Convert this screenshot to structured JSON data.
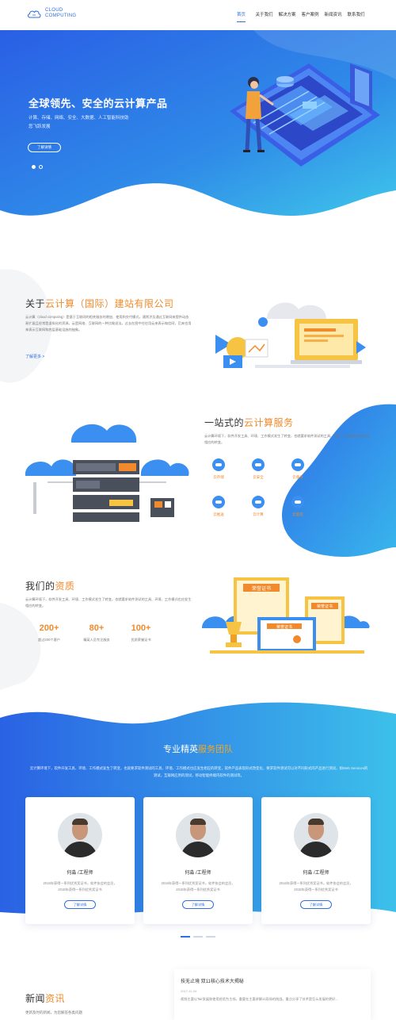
{
  "header": {
    "logo_line1": "CLOUD",
    "logo_line2": "COMPUTING",
    "nav": [
      {
        "label": "首页",
        "active": true
      },
      {
        "label": "关于我们",
        "active": false
      },
      {
        "label": "解决方案",
        "active": false
      },
      {
        "label": "客户案例",
        "active": false
      },
      {
        "label": "新闻资讯",
        "active": false
      },
      {
        "label": "联系我们",
        "active": false
      }
    ]
  },
  "hero": {
    "title": "全球领先、安全的云计算产品",
    "subtitle": "计算、存储、网络、安全、大数据、人工智能科技助您飞跃发展",
    "button": "了解详情",
    "slides": 2,
    "active_slide": 1
  },
  "about": {
    "title_prefix": "关于",
    "title_highlight": "云计算（国际）建站有限公司",
    "description": "云计算（cloud computing）是基于互联网的相关服务的增加、使用和交付模式，通常涉及通过互联网来提供动态易扩展且经常是虚拟化的资源。云是网络、互联网的一种比喻说法。过去在图中往往用云来表示电信网，后来也用来表示互联网和底层基础设施的抽象。",
    "link": "了解更多 >"
  },
  "services": {
    "title_prefix": "一站式的",
    "title_highlight": "云计算服务",
    "description": "云计算环境下，软件开发工具、环境、工作模式发生了转变，也就要求软件测试的工具、环境、工作模式也应发生相应的转变。",
    "items": [
      "云存储",
      "云安全",
      "云服务",
      "云推送",
      "云计算",
      "云监控"
    ]
  },
  "qualification": {
    "title_prefix": "我们的",
    "title_highlight": "资质",
    "description": "云计算环境下，软件开发工具、环境、工作模式发生了转变，也就要求软件测试的工具、环境、工作模式也应发生相应的转变。",
    "stats": [
      {
        "value": "200+",
        "label": "超过200个客户"
      },
      {
        "value": "80+",
        "label": "精英人员专注服务"
      },
      {
        "value": "100+",
        "label": "优质荣誉证书"
      }
    ],
    "illustration_text": [
      "荣誉证书",
      "荣誉证书",
      "荣誉证书"
    ]
  },
  "team": {
    "title_prefix": "专业精英",
    "title_highlight": "服务团队",
    "description": "云计算环境下，软件开发工具、环境、工作模式发生了转变，也就要求软件测试的工具、环境、工作模式也应发生相应的转变，软件产品表现形式改变化，要求软件测试可以对不同形式的产品进行测试，如Web Services的测试，互联网应用的测试，移动智能终端内软件的测试等。",
    "members": [
      {
        "name": "何淼 /工程师",
        "desc": "2016年获得一系列优秀奖证书，软件协会的会员，2018年获得一系列优秀奖证书",
        "button": "了解详情"
      },
      {
        "name": "何淼 /工程师",
        "desc": "2016年获得一系列优秀奖证书，软件协会的会员，2018年获得一系列优秀奖证书",
        "button": "了解详情"
      },
      {
        "name": "何淼 /工程师",
        "desc": "2016年获得一系列优秀奖证书，软件协会的会员，2018年获得一系列优秀奖证书",
        "button": "了解详情"
      }
    ]
  },
  "news": {
    "title_prefix": "新闻",
    "title_highlight": "资讯",
    "subtitle": "更新及时的新闻，为您解答各类问题",
    "item_title": "技无止境 双11核心技术大揭秘",
    "item_date": "2017-11-24",
    "item_desc": "视频主要以Tair发展和使用经验为主线，重要在主要讲解11双场的挑战。重点分享了技术是怎么发展的更好..."
  },
  "colors": {
    "brand": "#2f6fe0",
    "accent": "#f08a2c",
    "hero_start": "#2b63e6",
    "hero_end": "#3fc3ea"
  }
}
